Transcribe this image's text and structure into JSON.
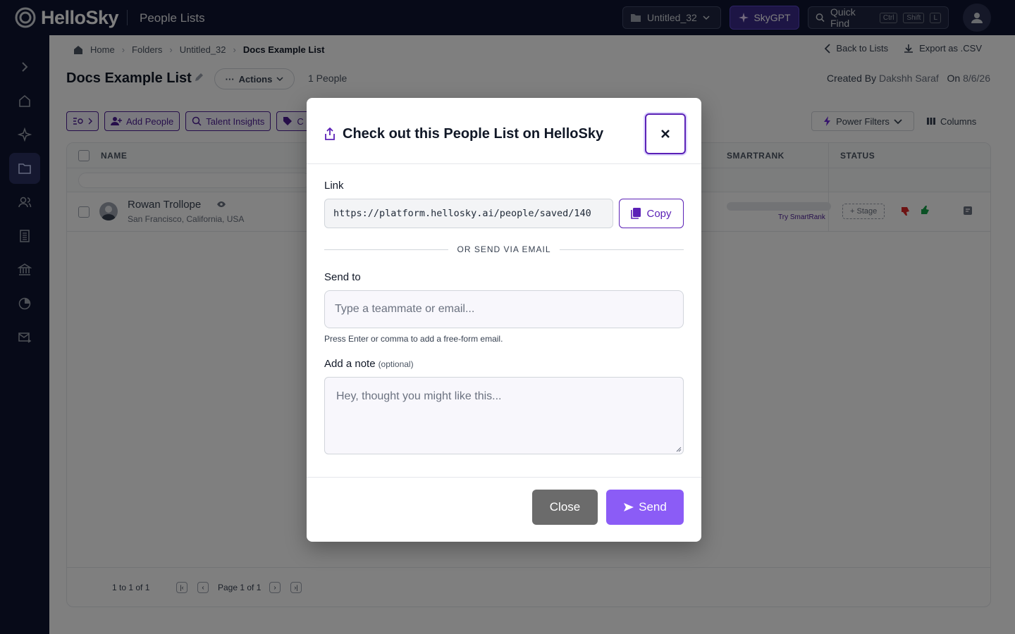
{
  "app": {
    "logo_text": "HelloSky",
    "section_title": "People Lists"
  },
  "topbar": {
    "folder_select": "Untitled_32",
    "skygpt_label": "SkyGPT",
    "quickfind_label": "Quick Find",
    "shortcut_keys": [
      "Ctrl",
      "Shift",
      "L"
    ]
  },
  "breadcrumb": [
    "Home",
    "Folders",
    "Untitled_32",
    "Docs Example List"
  ],
  "header_links": {
    "back": "Back to Lists",
    "export": "Export as .CSV"
  },
  "list": {
    "title": "Docs Example List",
    "actions_label": "Actions",
    "people_count": "1 People",
    "created_by_label": "Created By",
    "created_by_name": "Dakshh Saraf",
    "created_on_label": "On",
    "created_on_date": "8/6/26"
  },
  "toolbar": {
    "add_people": "Add People",
    "talent_insights": "Talent Insights",
    "tags_label": "C",
    "power_filters": "Power Filters",
    "columns": "Columns"
  },
  "table": {
    "headers": {
      "name": "NAME",
      "smartrank": "SMARTRANK",
      "status": "STATUS"
    },
    "rows": [
      {
        "name": "Rowan Trollope",
        "location": "San Francisco, California, USA",
        "stage": "+ Stage",
        "try_smartrank": "Try SmartRank"
      }
    ],
    "footer": {
      "range": "1 to 1 of 1",
      "page": "Page 1 of 1"
    }
  },
  "modal": {
    "title": "Check out this People List on HelloSky",
    "link_label": "Link",
    "link_value": "https://platform.hellosky.ai/people/saved/140",
    "copy_label": "Copy",
    "or_text": "OR SEND VIA EMAIL",
    "send_to_label": "Send to",
    "send_to_placeholder": "Type a teammate or email...",
    "hint": "Press Enter or comma to add a free-form email.",
    "note_label": "Add a note",
    "note_optional": "(optional)",
    "note_placeholder": "Hey, thought you might like this...",
    "close_label": "Close",
    "send_label": "Send"
  },
  "colors": {
    "brand_purple": "#5b21b6",
    "send_button": "#8b5cf6",
    "close_button": "#6b6b6b",
    "nav_background": "#0f1530"
  }
}
